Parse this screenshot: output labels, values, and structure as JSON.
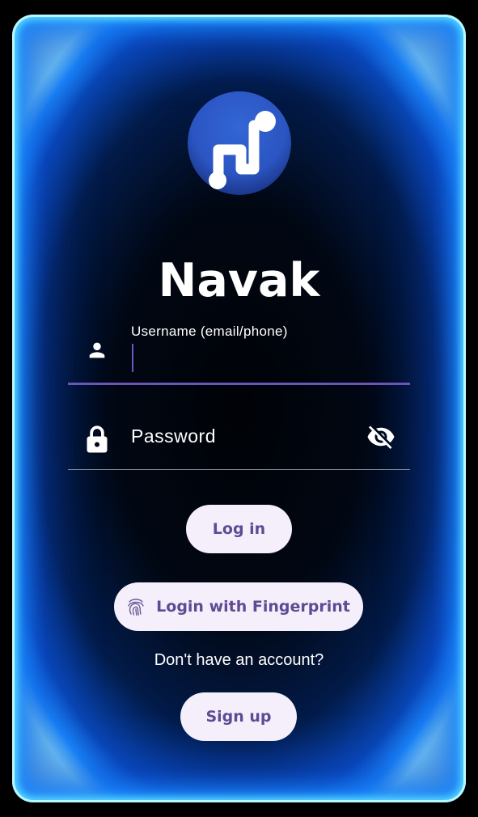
{
  "app": {
    "name": "Navak"
  },
  "logo": {
    "icon": "music-note-icon"
  },
  "login_form": {
    "username": {
      "label": "Username (email/phone)",
      "value": "",
      "icon": "person-icon"
    },
    "password": {
      "placeholder": "Password",
      "value": "",
      "icon": "lock-icon",
      "toggle_icon": "visibility-off-icon"
    },
    "login_button": {
      "label": "Log in"
    },
    "fingerprint_button": {
      "label": "Login with Fingerprint",
      "icon": "fingerprint-icon"
    },
    "signup_prompt": "Don't have an account?",
    "signup_button": {
      "label": "Sign up"
    }
  },
  "colors": {
    "accent": "#6b55b8",
    "button_background": "#f4effb",
    "button_text": "#5f4a94",
    "glow": "#1c8dff"
  }
}
